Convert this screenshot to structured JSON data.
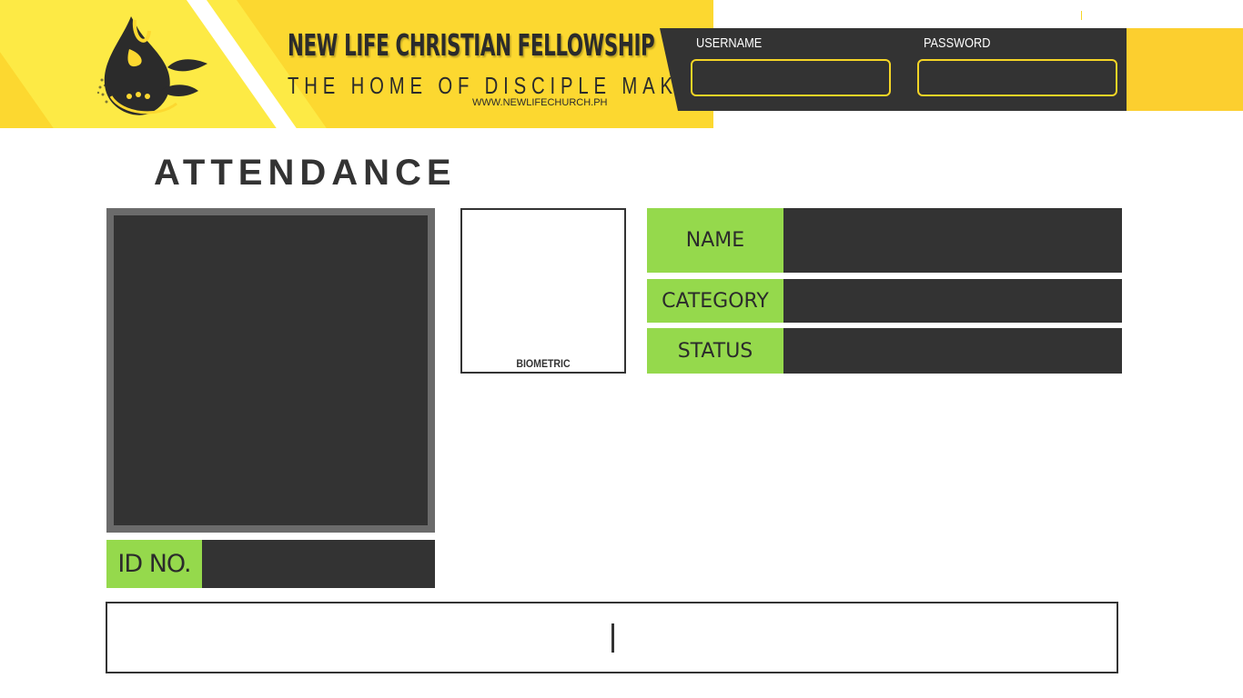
{
  "header": {
    "org_name": "NEW LIFE CHRISTIAN FELLOWSHIP",
    "tagline": "THE HOME OF DISCIPLE MAKERS",
    "website": "WWW.NEWLIFECHURCH.PH",
    "logo_icon": "flame-droplet-sprout-logo"
  },
  "login": {
    "username_label": "USERNAME",
    "password_label": "PASSWORD",
    "username_value": "",
    "password_value": ""
  },
  "attendance": {
    "title": "ATTENDANCE",
    "id_label": "ID NO.",
    "id_value": "",
    "biometric_label": "BIOMETRIC",
    "fields": [
      {
        "label": "NAME",
        "value": ""
      },
      {
        "label": "CATEGORY",
        "value": ""
      },
      {
        "label": "STATUS",
        "value": ""
      }
    ],
    "scan_value": ""
  },
  "colors": {
    "banner_yellow": "#fcd830",
    "banner_light": "#fdea45",
    "dark_panel": "#333333",
    "photo_border": "#6b6b6b",
    "label_green": "#95d94c",
    "field_border": "#f5d526"
  }
}
